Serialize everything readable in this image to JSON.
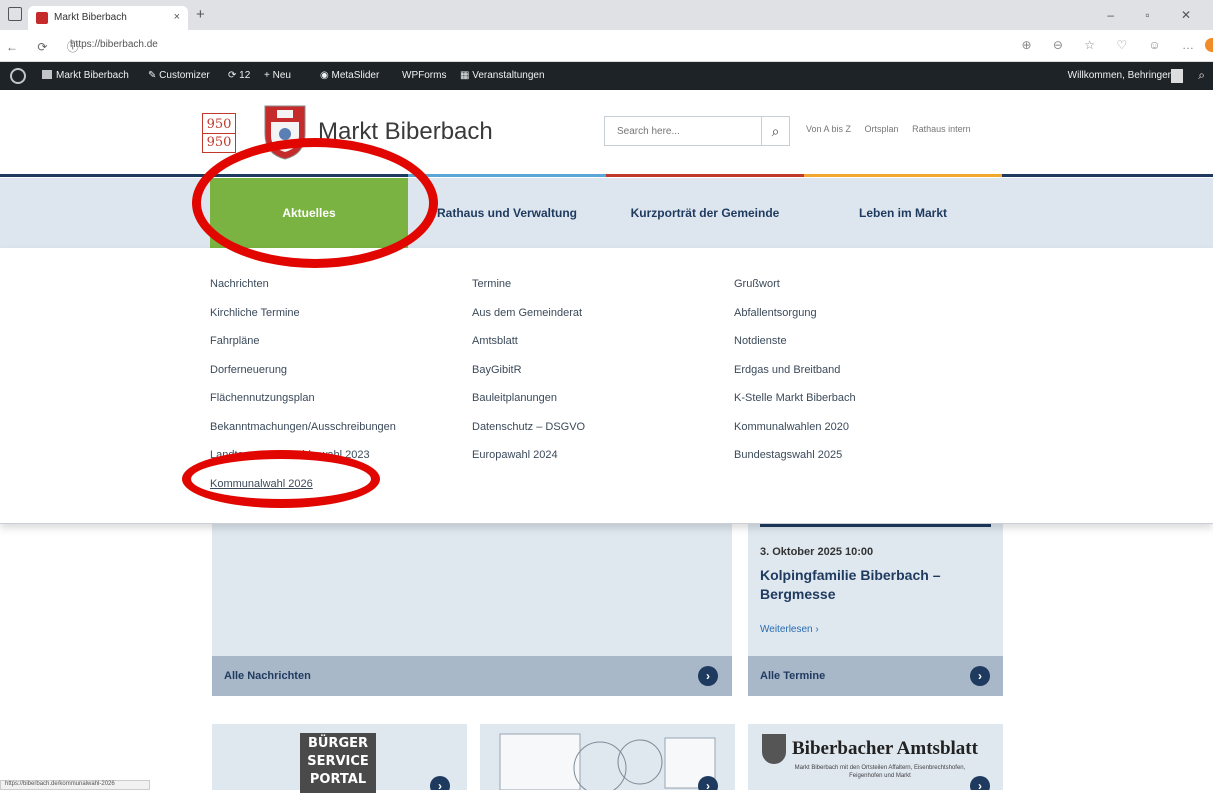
{
  "browser": {
    "tab_title": "Markt Biberbach",
    "tab_close": "×",
    "new_tab": "+",
    "url": "https://biberbach.de",
    "status_url": "https://biberbach.de/kommunalwahl-2026"
  },
  "admin_bar": {
    "site": "Markt Biberbach",
    "customizer": "Customizer",
    "updates": "12",
    "new": "Neu",
    "metaslider": "MetaSlider",
    "wpforms": "WPForms",
    "events": "Veranstaltungen",
    "welcome": "Willkommen, Behringer"
  },
  "header": {
    "logo_950_top": "950",
    "logo_950_bottom": "950",
    "site_name": "Markt Biberbach",
    "search_placeholder": "Search here...",
    "quick_links": [
      "Von A bis Z",
      "Ortsplan",
      "Rathaus intern"
    ]
  },
  "nav": {
    "tabs": [
      "Aktuelles",
      "Rathaus und Verwaltung",
      "Kurzporträt der Gemeinde",
      "Leben im Markt"
    ],
    "active": "Aktuelles",
    "accent_color": "#7ab342",
    "stripe_colors": [
      "#1f3a5f",
      "#5aa6d6",
      "#c0392b",
      "#f0a830",
      "#1f3a5f"
    ]
  },
  "mega_menu": {
    "col1": [
      "Nachrichten",
      "Kirchliche Termine",
      "Fahrpläne",
      "Dorferneuerung",
      "Flächennutzungsplan",
      "Bekanntmachungen/Ausschreibungen",
      "Landtags- und Bezirkswahl 2023",
      "Kommunalwahl 2026"
    ],
    "col2": [
      "Termine",
      "Aus dem Gemeinderat",
      "Amtsblatt",
      "BayGibitR",
      "Bauleitplanungen",
      "Datenschutz – DSGVO",
      "Europawahl 2024"
    ],
    "col3": [
      "Grußwort",
      "Abfallentsorgung",
      "Notdienste",
      "Erdgas und Breitband",
      "K-Stelle Markt Biberbach",
      "Kommunalwahlen 2020",
      "Bundestagswahl 2025"
    ]
  },
  "content": {
    "news_footer": "Alle Nachrichten",
    "event_date": "3. Oktober 2025 10:00",
    "event_title": "Kolpingfamilie Biberbach – Bergmesse",
    "event_more": "Weiterlesen ›",
    "terms_footer": "Alle Termine",
    "buerger_lines": [
      "BÜRGER",
      "SERVICE",
      "PORTAL"
    ],
    "amtsblatt_title": "Biberbacher Amtsblatt",
    "amtsblatt_sub": "Markt Biberbach mit den Ortsteilen Affaltern, Eisenbrechtshofen, Feigenhofen und Markt"
  }
}
